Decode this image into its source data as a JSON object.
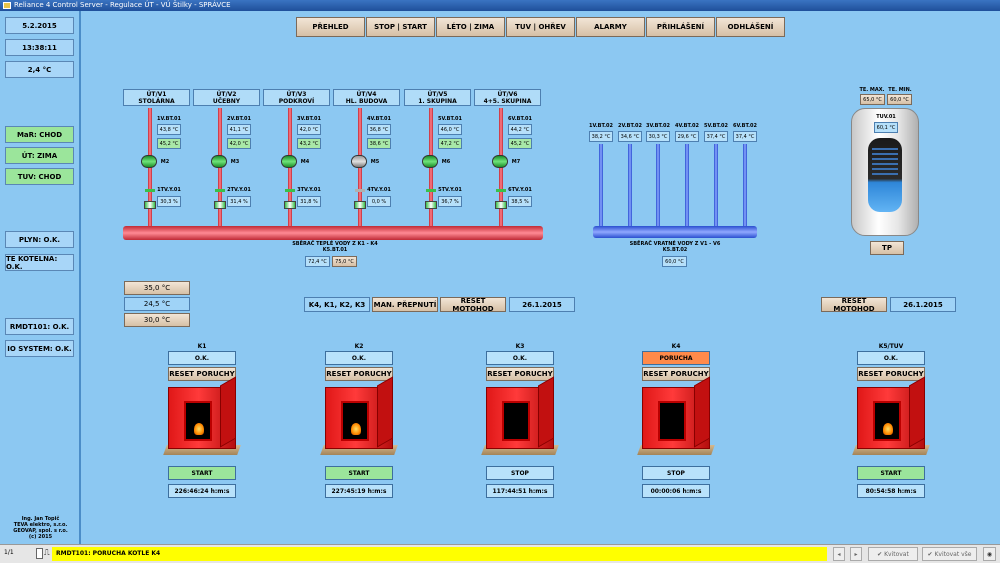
{
  "window": {
    "title": "Reliance 4 Control Server - Regulace ÚT - VÚ Štilky - SPRÁVCE"
  },
  "sidebar": {
    "date": "5.2.2015",
    "time": "13:38:11",
    "temp": "2,4 °C",
    "status": [
      "MaR: CHOD",
      "ÚT: ZIMA",
      "TUV: CHOD"
    ],
    "gas": "PLYN: O.K.",
    "te_kotelna": "TE KOTELNA: O.K.",
    "rmdt": "RMDT101: O.K.",
    "io": "IO SYSTEM: O.K.",
    "footer": [
      "Ing. Jan Topič",
      "TEVA elektro, s.r.o.",
      "GEOVAP, spol. s r.o.",
      "(c) 2015"
    ]
  },
  "nav": [
    "PŘEHLED",
    "STOP | START",
    "LÉTO | ZIMA",
    "TUV | OHŘEV",
    "ALARMY",
    "PŘIHLÁŠENÍ",
    "ODHLÁŠENÍ"
  ],
  "circuits": [
    {
      "t1": "ÚT/V1",
      "t2": "STOLÁRNA",
      "tag": "1V.BT.01",
      "v1": "43,8 °C",
      "v2": "45,2 °C",
      "pump": "M2",
      "valve": "1TV.Y.01",
      "pct": "30,3 %"
    },
    {
      "t1": "ÚT/V2",
      "t2": "UČEBNY",
      "tag": "2V.BT.01",
      "v1": "41,1 °C",
      "v2": "42,0 °C",
      "pump": "M3",
      "valve": "2TV.Y.01",
      "pct": "31,4 %"
    },
    {
      "t1": "ÚT/V3",
      "t2": "PODKROVÍ",
      "tag": "3V.BT.01",
      "v1": "42,0 °C",
      "v2": "43,2 °C",
      "pump": "M4",
      "valve": "3TV.Y.01",
      "pct": "31,8 %"
    },
    {
      "t1": "ÚT/V4",
      "t2": "HL. BUDOVA",
      "tag": "4V.BT.01",
      "v1": "36,8 °C",
      "v2": "38,6 °C",
      "pump": "M5",
      "valve": "4TV.Y.01",
      "pct": "0,0 %"
    },
    {
      "t1": "ÚT/V5",
      "t2": "1. SKUPINA",
      "tag": "5V.BT.01",
      "v1": "46,0 °C",
      "v2": "47,2 °C",
      "pump": "M6",
      "valve": "5TV.Y.01",
      "pct": "36,7 %"
    },
    {
      "t1": "ÚT/V6",
      "t2": "4+5. SKUPINA",
      "tag": "6V.BT.01",
      "v1": "44,2 °C",
      "v2": "45,2 °C",
      "pump": "M7",
      "valve": "6TV.Y.01",
      "pct": "38,5 %"
    }
  ],
  "returns": [
    {
      "tag": "1V.BT.02",
      "v": "38,2 °C"
    },
    {
      "tag": "2V.BT.02",
      "v": "34,6 °C"
    },
    {
      "tag": "3V.BT.02",
      "v": "30,3 °C"
    },
    {
      "tag": "4V.BT.02",
      "v": "29,6 °C"
    },
    {
      "tag": "5V.BT.02",
      "v": "37,4 °C"
    },
    {
      "tag": "6V.BT.02",
      "v": "37,4 °C"
    }
  ],
  "collector": {
    "hot_l1": "SBĚRAČ TEPLÉ VODY Z K1 - K4",
    "hot_l2": "K5.BT.01",
    "hot_v1": "72,4 °C",
    "hot_v2": "75,0 °C",
    "ret_l1": "SBĚRAČ VRATNÉ VODY Z V1 - V6",
    "ret_l2": "K5.BT.02",
    "ret_v": "60,0 °C"
  },
  "tuv": {
    "tmax_label": "TE. MAX.",
    "tmin_label": "TE. MIN.",
    "tmax": "65,0 °C",
    "tmin": "60,0 °C",
    "tag": "TUV.01",
    "temp": "60,1 °C",
    "tp": "TP"
  },
  "setpoints": [
    "35,0 °C",
    "24,5 °C",
    "30,0 °C"
  ],
  "seq": {
    "order": "K4, K1, K2, K3",
    "man": "MAN. PŘEPNUTÍ",
    "reset": "RESET MOTOHOD",
    "date": "26.1.2015",
    "reset2": "RESET MOTOHOD",
    "date2": "26.1.2015"
  },
  "boilers": [
    {
      "name": "K1",
      "status": "O.K.",
      "reset": "RESET PORUCHY",
      "cmd": "START",
      "hours": "226:46:24 h:m:s",
      "fire": true
    },
    {
      "name": "K2",
      "status": "O.K.",
      "reset": "RESET PORUCHY",
      "cmd": "START",
      "hours": "227:45:19 h:m:s",
      "fire": true
    },
    {
      "name": "K3",
      "status": "O.K.",
      "reset": "RESET PORUCHY",
      "cmd": "STOP",
      "hours": "117:44:51 h:m:s",
      "fire": false
    },
    {
      "name": "K4",
      "status": "PORUCHA",
      "reset": "RESET PORUCHY",
      "cmd": "STOP",
      "hours": "00:00:06 h:m:s",
      "fire": false
    },
    {
      "name": "K5/TUV",
      "status": "O.K.",
      "reset": "RESET PORUCHY",
      "cmd": "START",
      "hours": "80:54:58 h:m:s",
      "fire": true
    }
  ],
  "statusbar": {
    "page": "1/1",
    "alarm": "RMDT101: PORUCHA KOTLE K4",
    "ack": "Kvitovat",
    "ack_all": "Kvitovat vše"
  }
}
